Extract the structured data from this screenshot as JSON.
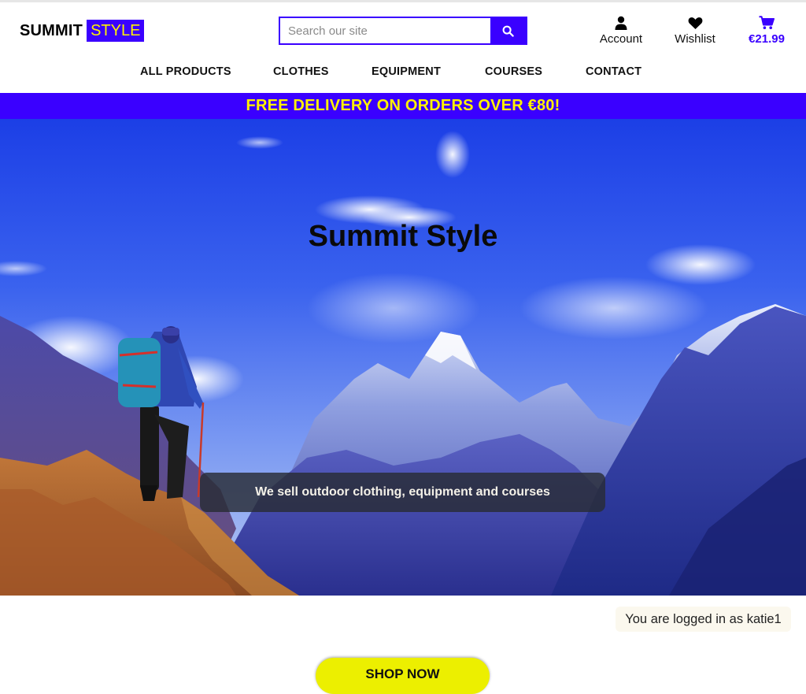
{
  "brand": {
    "left": "SUMMIT",
    "right": "STYLE"
  },
  "search": {
    "placeholder": "Search our site",
    "icon": "search-icon"
  },
  "header": {
    "account": {
      "label": "Account",
      "icon": "user-icon"
    },
    "wishlist": {
      "label": "Wishlist",
      "icon": "heart-icon"
    },
    "bag": {
      "label": "€21.99",
      "icon": "cart-icon"
    }
  },
  "nav": {
    "items": [
      {
        "label": "ALL PRODUCTS"
      },
      {
        "label": "CLOTHES"
      },
      {
        "label": "EQUIPMENT"
      },
      {
        "label": "COURSES"
      },
      {
        "label": "CONTACT"
      }
    ]
  },
  "banner": {
    "text": "FREE DELIVERY ON ORDERS OVER €80!"
  },
  "hero": {
    "title": "Summit Style",
    "caption": "We sell outdoor clothing, equipment and courses"
  },
  "status": {
    "logged_in": "You are logged in as katie1"
  },
  "cta": {
    "label": "SHOP NOW"
  },
  "colors": {
    "brand": "#3a00ff",
    "accent": "#fff200",
    "button": "#ecef00"
  }
}
